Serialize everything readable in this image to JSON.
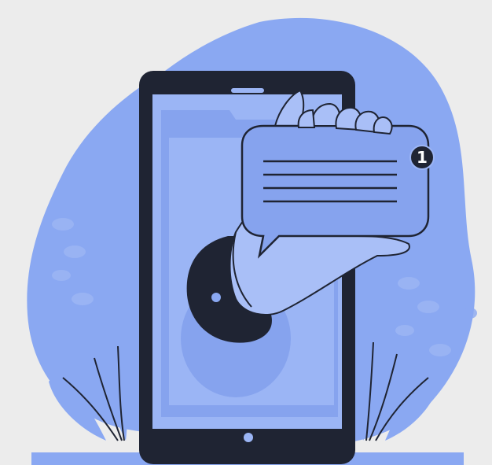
{
  "illustration": {
    "subject": "hand-holding-message-out-of-phone",
    "icons": [
      "phone-icon",
      "hand-icon",
      "speech-bubble-icon",
      "notification-badge-icon",
      "leaf-plant-icon"
    ],
    "notification_badge": {
      "count": "1"
    },
    "colors": {
      "background": "#ececec",
      "blob": "#8aa8f2",
      "screen": "#9bb5f5",
      "phone_body": "#1f2433",
      "bubble": "#86a3ee",
      "hand": "#a9bff7",
      "sleeve": "#1f2433",
      "badge": "#1f2433"
    }
  }
}
